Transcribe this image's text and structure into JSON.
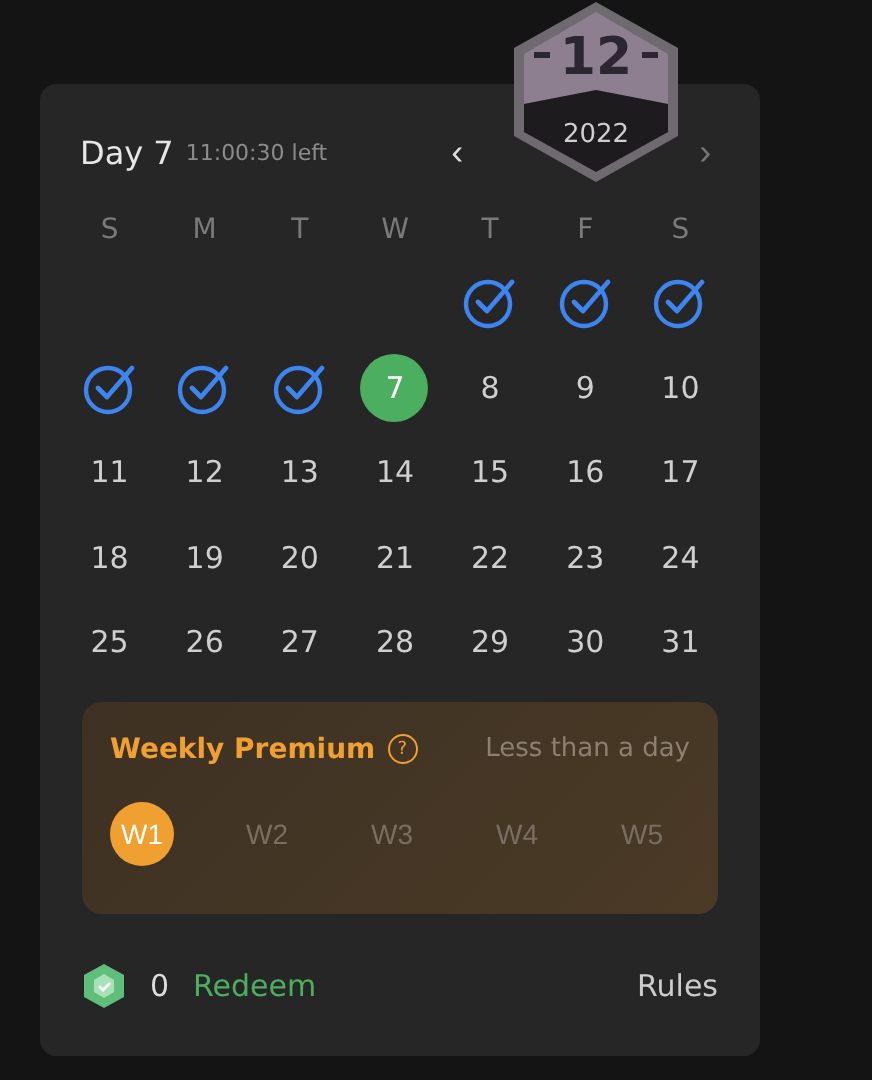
{
  "header": {
    "title": "Day 7",
    "countdown": "11:00:30 left",
    "prev": "‹",
    "next": "›"
  },
  "badge": {
    "month": "12",
    "year": "2022"
  },
  "weekdays": [
    "S",
    "M",
    "T",
    "W",
    "T",
    "F",
    "S"
  ],
  "weeks": [
    [
      {
        "kind": "blank"
      },
      {
        "kind": "blank"
      },
      {
        "kind": "blank"
      },
      {
        "kind": "blank"
      },
      {
        "kind": "claimed"
      },
      {
        "kind": "claimed"
      },
      {
        "kind": "claimed"
      }
    ],
    [
      {
        "kind": "claimed"
      },
      {
        "kind": "claimed"
      },
      {
        "kind": "claimed"
      },
      {
        "kind": "today",
        "label": "7"
      },
      {
        "kind": "day",
        "label": "8"
      },
      {
        "kind": "day",
        "label": "9"
      },
      {
        "kind": "day",
        "label": "10"
      }
    ],
    [
      {
        "kind": "day",
        "label": "11"
      },
      {
        "kind": "day",
        "label": "12"
      },
      {
        "kind": "day",
        "label": "13"
      },
      {
        "kind": "day",
        "label": "14"
      },
      {
        "kind": "day",
        "label": "15"
      },
      {
        "kind": "day",
        "label": "16"
      },
      {
        "kind": "day",
        "label": "17"
      }
    ],
    [
      {
        "kind": "day",
        "label": "18"
      },
      {
        "kind": "day",
        "label": "19"
      },
      {
        "kind": "day",
        "label": "20"
      },
      {
        "kind": "day",
        "label": "21"
      },
      {
        "kind": "day",
        "label": "22"
      },
      {
        "kind": "day",
        "label": "23"
      },
      {
        "kind": "day",
        "label": "24"
      }
    ],
    [
      {
        "kind": "day",
        "label": "25"
      },
      {
        "kind": "day",
        "label": "26"
      },
      {
        "kind": "day",
        "label": "27"
      },
      {
        "kind": "day",
        "label": "28"
      },
      {
        "kind": "day",
        "label": "29"
      },
      {
        "kind": "day",
        "label": "30"
      },
      {
        "kind": "day",
        "label": "31"
      }
    ]
  ],
  "premium": {
    "title": "Weekly Premium",
    "help": "?",
    "remaining": "Less than a day",
    "weeks": [
      {
        "label": "W1",
        "selected": true
      },
      {
        "label": "W2",
        "selected": false
      },
      {
        "label": "W3",
        "selected": false
      },
      {
        "label": "W4",
        "selected": false
      },
      {
        "label": "W5",
        "selected": false
      }
    ]
  },
  "footer": {
    "points": "0",
    "redeem": "Redeem",
    "rules": "Rules"
  }
}
